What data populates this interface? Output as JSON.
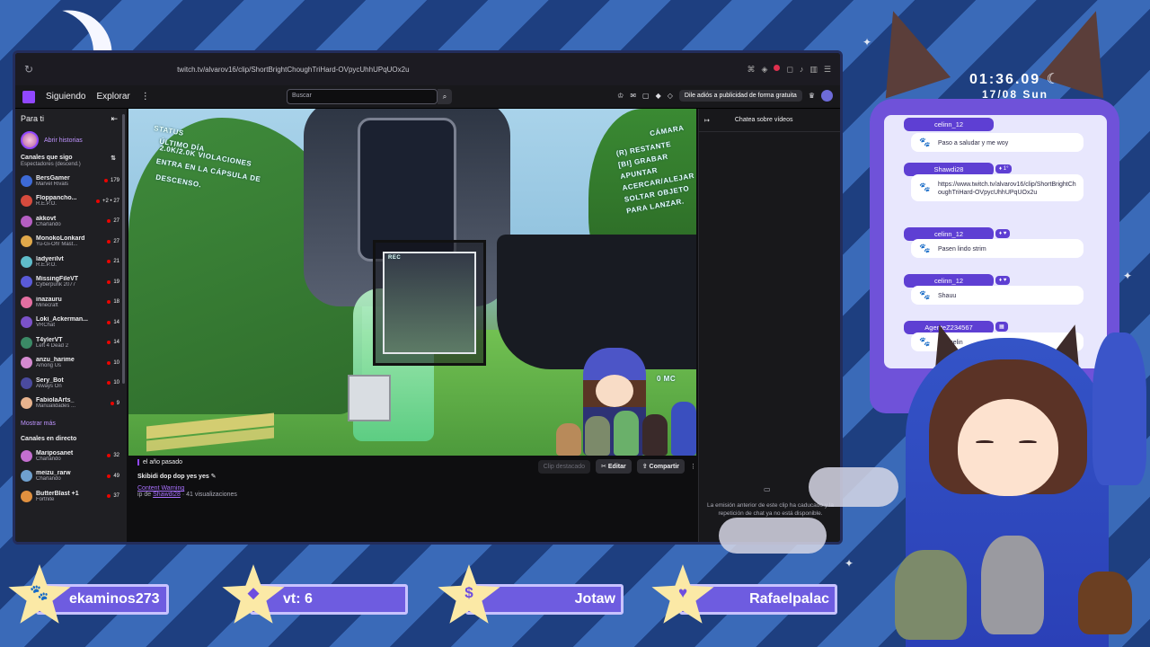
{
  "overlay": {
    "clock_time": "01:36.09",
    "clock_date": "17/08 Sun"
  },
  "browser": {
    "url": "twitch.tv/alvarov16/clip/ShortBrightChoughTriHard-OVpycUhhUPqUOx2u"
  },
  "twitch_header": {
    "following": "Siguiendo",
    "browse": "Explorar",
    "search_placeholder": "Buscar",
    "ads_button": "Dile adiós a publicidad de forma gratuita"
  },
  "sidebar": {
    "title": "Para ti",
    "story_label": "Abrir historias",
    "followed_section": "Canales que sigo",
    "followed_sort": "Espectadores (descend.)",
    "channels": [
      {
        "name": "BersGamer",
        "game": "Marvel Rivals",
        "viewers": "179",
        "color": "#3d6ad6"
      },
      {
        "name": "Floppancho...",
        "game": "R.E.P.O.",
        "viewers": "+2 • 27",
        "color": "#d64b3d"
      },
      {
        "name": "akkovt",
        "game": "Charlando",
        "viewers": "27",
        "color": "#b45ec2"
      },
      {
        "name": "MonokoLonkard",
        "game": "Yu-Gi-Oh! Mast...",
        "viewers": "27",
        "color": "#e0a84a"
      },
      {
        "name": "ladyerilvt",
        "game": "R.E.P.O.",
        "viewers": "21",
        "color": "#5fbcc9"
      },
      {
        "name": "MissingFileVT",
        "game": "Cyberpunk 2077",
        "viewers": "19",
        "color": "#5a5ad8"
      },
      {
        "name": "inazauru",
        "game": "Minecraft",
        "viewers": "18",
        "color": "#e46fa2"
      },
      {
        "name": "Loki_Ackerman...",
        "game": "VRChat",
        "viewers": "14",
        "color": "#7b52c9"
      },
      {
        "name": "T4ylerVT",
        "game": "Left 4 Dead 2",
        "viewers": "14",
        "color": "#3b8a66"
      },
      {
        "name": "anzu_harime",
        "game": "Among Us",
        "viewers": "10",
        "color": "#d48ad0"
      },
      {
        "name": "Sery_Bot",
        "game": "Always On",
        "viewers": "10",
        "color": "#4a4a9e"
      },
      {
        "name": "FabiolaArts_",
        "game": "Manualidades ...",
        "viewers": "9",
        "color": "#e7b38e"
      }
    ],
    "show_more": "Mostrar más",
    "live_section": "Canales en directo",
    "live_channels": [
      {
        "name": "Mariposanet",
        "game": "Charlando",
        "viewers": "32",
        "color": "#c46fcf"
      },
      {
        "name": "meizu_rarw",
        "game": "Charlando",
        "viewers": "49",
        "color": "#6fa0cf"
      },
      {
        "name": "ButterBlast +1",
        "game": "Fortnite",
        "viewers": "37",
        "color": "#e0903f"
      }
    ]
  },
  "video_hud": {
    "status": "STATUS",
    "day": "ÚLTIMO DÍA",
    "quota": "2.0K/2.0K VIOLACIONES",
    "enter": "ENTRA EN LA CÁPSULA DE",
    "descend": "DESCENSO.",
    "camera": "CÁMARA",
    "camera_lines": [
      "(R) RESTANTE",
      "[BI] GRABAR",
      "APUNTAR",
      "ACERCAR/ALEJAR",
      "SOLTAR OBJETO",
      "PARA LANZAR."
    ],
    "money": "0 MC",
    "rec": "REC"
  },
  "clip": {
    "time_ago": "el año pasado",
    "title": "Skibidi dop dop yes yes",
    "content_warning": "Content Warning",
    "clip_by_prefix": "ip de",
    "clipper": "Shawdi28",
    "views": "· 41 visualizaciones",
    "featured": "Clip destacado",
    "edit": "Editar",
    "share": "Compartir"
  },
  "chat_panel": {
    "title": "Chatea sobre vídeos",
    "message": "La emisión anterior de este clip ha caducado y la repetición de chat ya no está disponible."
  },
  "overlay_chat": [
    {
      "user": "celinn_12",
      "message": "Paso a saludar y me woy"
    },
    {
      "user": "Shawdi28",
      "badges": "♦ 1°",
      "message": "https://www.twitch.tv/alvarov16/clip/ShortBrightChoughTriHard-OVpycUhhUPqUOx2u"
    },
    {
      "user": "celinn_12",
      "badges": "♦ ♥",
      "message": "Pasen lindo strim"
    },
    {
      "user": "celinn_12",
      "badges": "♦ ♥",
      "message": "Shauu"
    },
    {
      "user": "AgenteZ234567",
      "badges": "▦",
      "message": "ese celin"
    }
  ],
  "bottom_bar": [
    {
      "icon": "paw-icon",
      "glyph": "🐾",
      "text": "ekaminos273"
    },
    {
      "icon": "diamond-icon",
      "glyph": "◆",
      "text": "vt: 6"
    },
    {
      "icon": "dollar-icon",
      "glyph": "$",
      "text": "Jotaw"
    },
    {
      "icon": "heart-icon",
      "glyph": "♥",
      "text": "Rafaelpalac"
    }
  ],
  "colors": {
    "twitch_purple": "#9147ff",
    "overlay_purple": "#6f52d9",
    "star_yellow": "#fbe9a6"
  }
}
